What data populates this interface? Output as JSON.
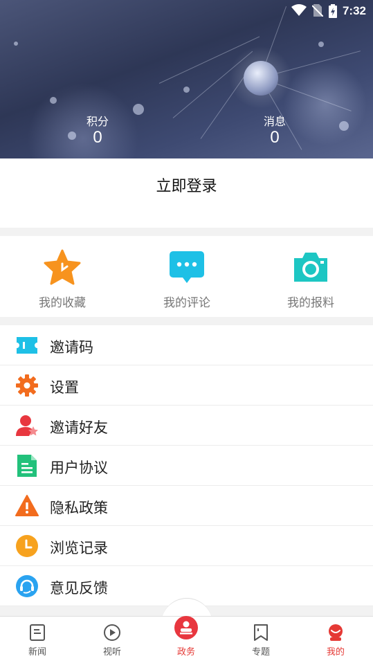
{
  "status_bar": {
    "time": "7:32"
  },
  "header": {
    "stats": [
      {
        "label": "积分",
        "value": "0"
      },
      {
        "label": "消息",
        "value": "0"
      }
    ]
  },
  "login": {
    "label": "立即登录"
  },
  "quick_actions": [
    {
      "label": "我的收藏",
      "icon": "star-icon",
      "color": "#f7931e"
    },
    {
      "label": "我的评论",
      "icon": "comment-icon",
      "color": "#1ec0e6"
    },
    {
      "label": "我的报料",
      "icon": "camera-icon",
      "color": "#1dc6c3"
    }
  ],
  "menu": [
    {
      "label": "邀请码",
      "icon": "ticket-icon",
      "color": "#1ec0e6"
    },
    {
      "label": "设置",
      "icon": "gear-icon",
      "color": "#f26c1e"
    },
    {
      "label": "邀请好友",
      "icon": "invite-friend-icon",
      "color": "#e8373f"
    },
    {
      "label": "用户协议",
      "icon": "document-icon",
      "color": "#22c17b"
    },
    {
      "label": "隐私政策",
      "icon": "warning-icon",
      "color": "#f26c1e"
    },
    {
      "label": "浏览记录",
      "icon": "clock-icon",
      "color": "#f7a21e"
    },
    {
      "label": "意见反馈",
      "icon": "headset-icon",
      "color": "#2aa3f0"
    }
  ],
  "tabs": [
    {
      "label": "新闻",
      "icon": "news-icon",
      "active": false
    },
    {
      "label": "视听",
      "icon": "play-icon",
      "active": false
    },
    {
      "label": "政务",
      "icon": "government-icon",
      "active": false
    },
    {
      "label": "专题",
      "icon": "bookmark-icon",
      "active": false
    },
    {
      "label": "我的",
      "icon": "profile-icon",
      "active": true
    }
  ],
  "colors": {
    "accent": "#e53935"
  }
}
